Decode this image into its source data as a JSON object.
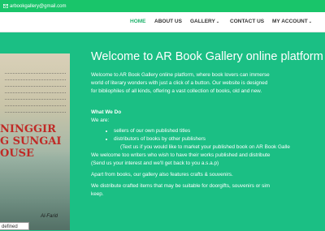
{
  "topbar": {
    "email": "arbookgallery@gmail.com",
    "email_icon": "mail-icon"
  },
  "nav": {
    "items": [
      {
        "label": "HOME",
        "active": true,
        "dropdown": false
      },
      {
        "label": "ABOUT US",
        "active": false,
        "dropdown": false
      },
      {
        "label": "GALLERY",
        "active": false,
        "dropdown": true
      },
      {
        "label": "CONTACT US",
        "active": false,
        "dropdown": false
      },
      {
        "label": "MY ACCOUNT",
        "active": false,
        "dropdown": true
      }
    ]
  },
  "book": {
    "title_lines": [
      "NINGGIR",
      "G SUNGAI",
      "OUSE"
    ],
    "author": "Al-Farid"
  },
  "undefined_tag": "defined",
  "main": {
    "title": "Welcome to AR Book Gallery online platform",
    "intro": [
      "Welcome to AR Book Gallery online platform, where book lovers can immerse",
      "world of literary wonders with just a click of a button. Our website is designed",
      "for bibliophiles of all kinds, offering a vast collection of books, old and new."
    ],
    "what_we_do_heading": "What We Do",
    "we_are": "We are:",
    "bullets": [
      "sellers of our own published titles",
      "distributors of books by other publishers"
    ],
    "publish_note": "(Text us if you would like to market your published book on AR Book Galle",
    "welcome_writers": "We welcome too writers who wish to have their works published and distribute",
    "send_interest": "(Send us your interest and we'll get back to you a.s.a.p)",
    "crafts": "Apart from books, our gallery also features crafts & souvenirs.",
    "distribute_1": "We distribute crafted items that may be suitable for doorgifts, souvenirs or sim",
    "distribute_2": "keep."
  }
}
